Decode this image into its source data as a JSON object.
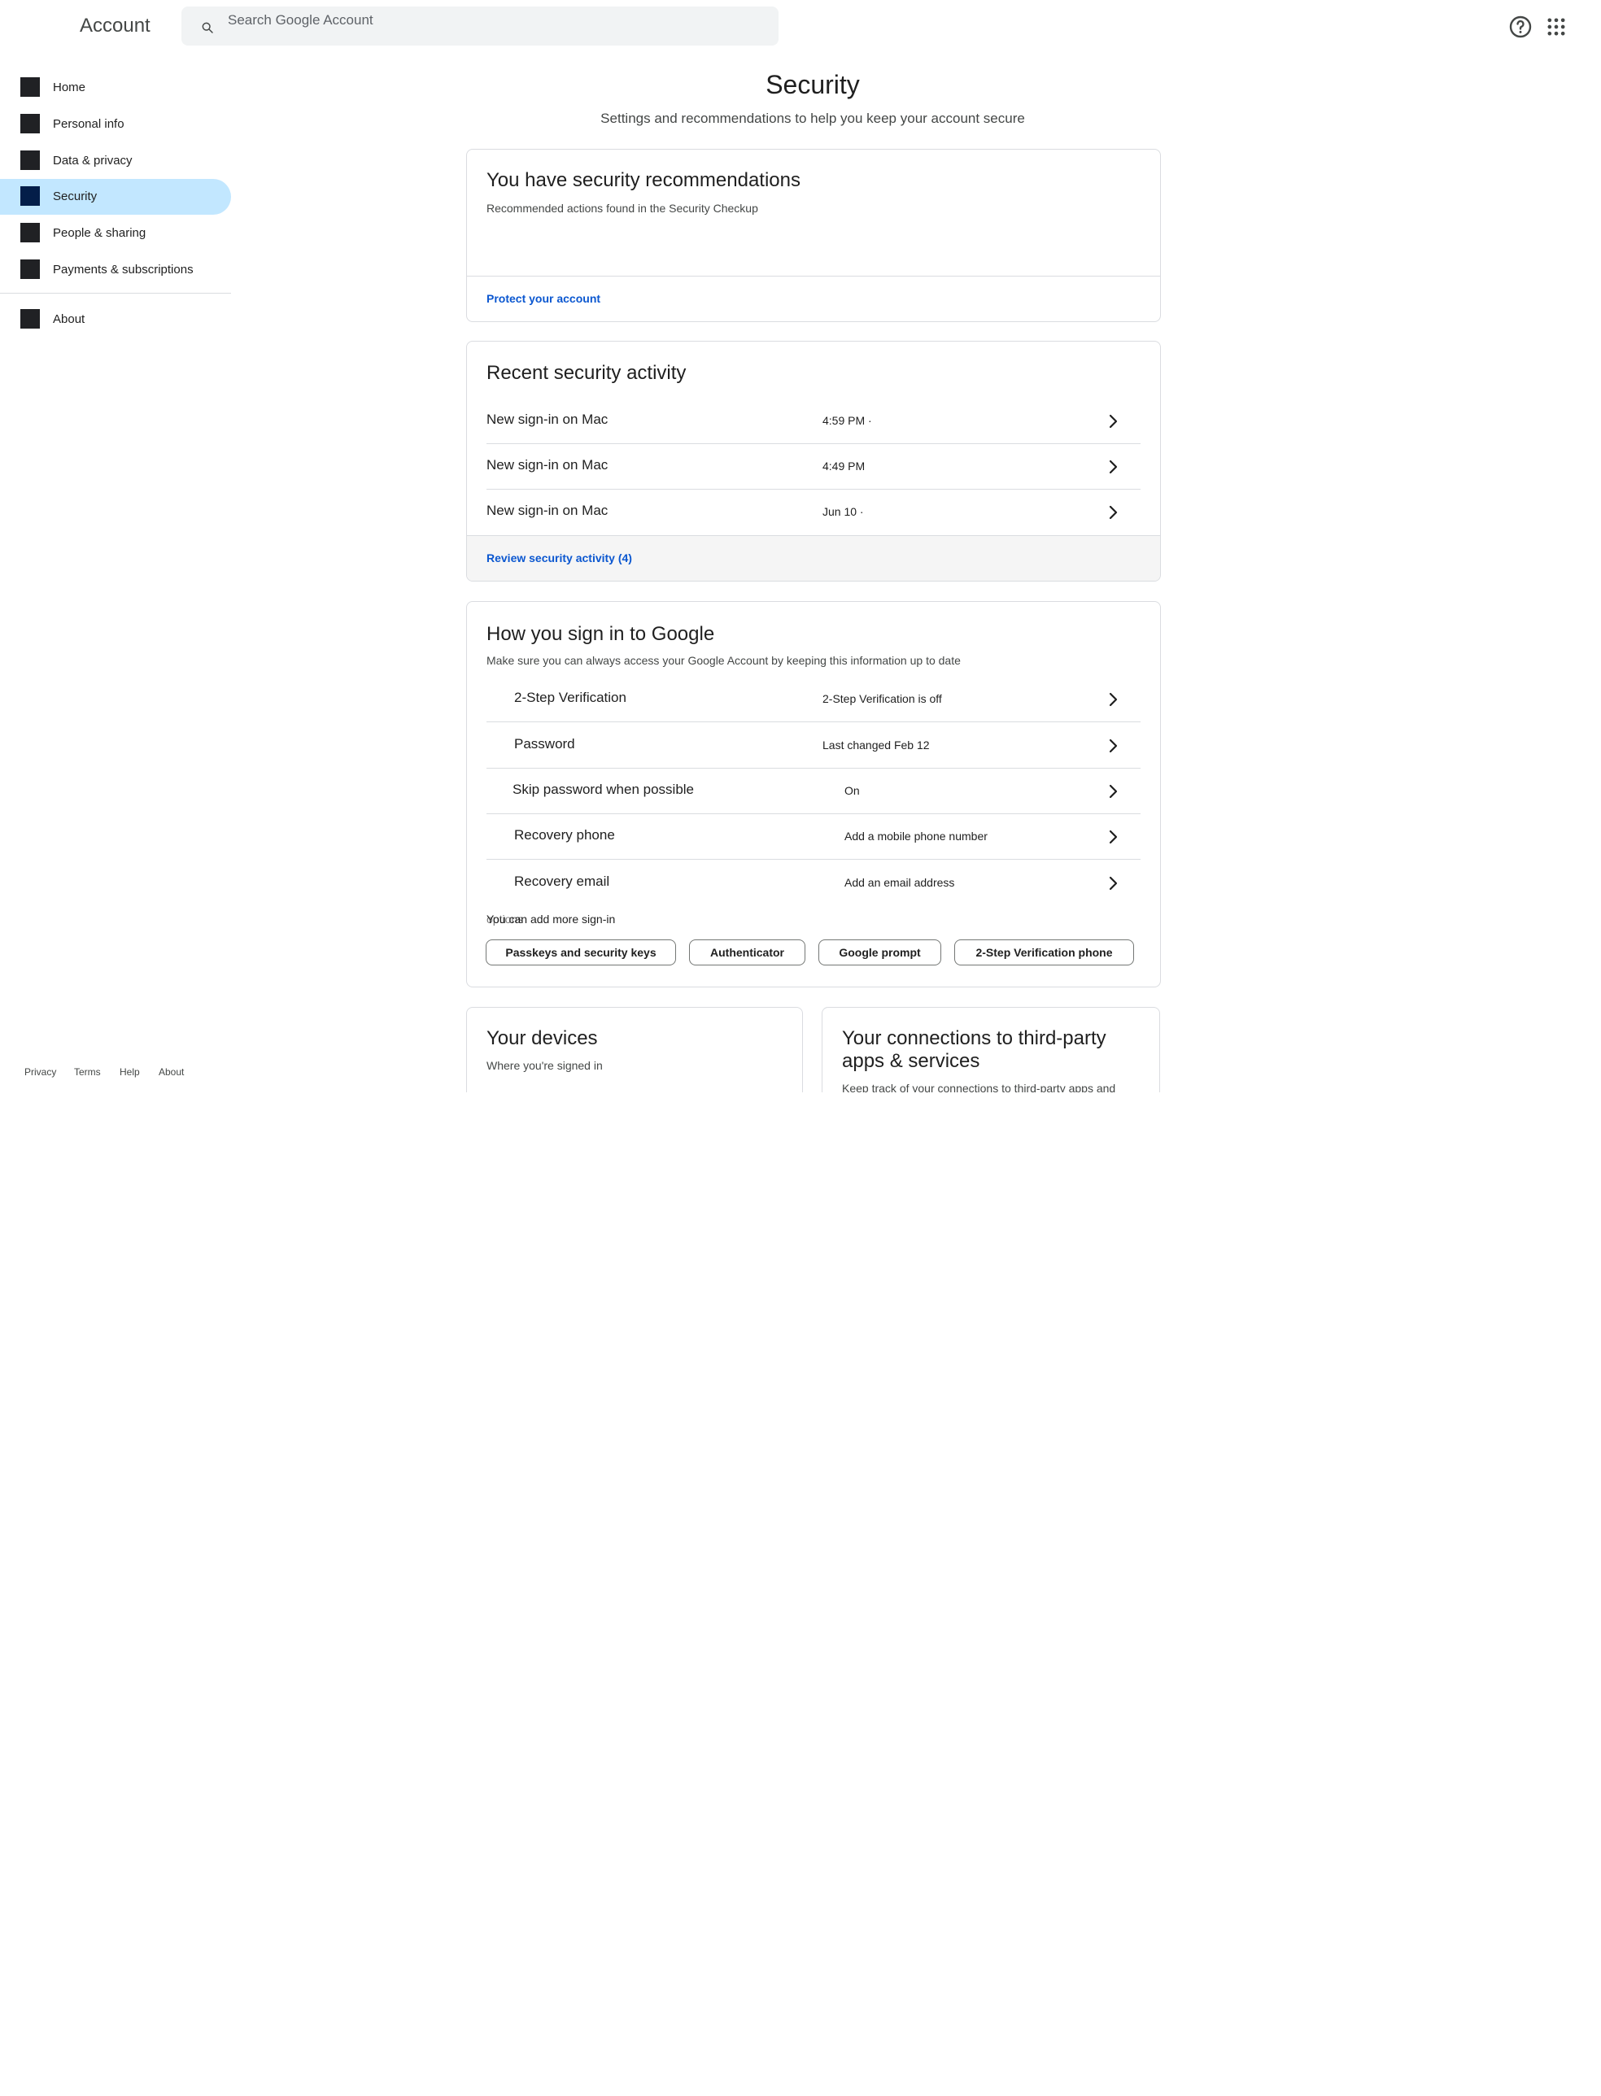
{
  "header": {
    "app_title": "Account",
    "search_placeholder": "Search Google Account"
  },
  "sidebar": {
    "items": [
      {
        "label": "Home",
        "icon": "home-icon"
      },
      {
        "label": "Personal info",
        "icon": "person-icon"
      },
      {
        "label": "Data & privacy",
        "icon": "privacy-icon"
      },
      {
        "label": "Security",
        "icon": "lock-icon",
        "active": true
      },
      {
        "label": "People & sharing",
        "icon": "people-icon"
      },
      {
        "label": "Payments & subscriptions",
        "icon": "payment-icon"
      },
      {
        "label": "About",
        "icon": "info-icon"
      }
    ],
    "footer": [
      "Privacy",
      "Terms",
      "Help",
      "About"
    ]
  },
  "page": {
    "title": "Security",
    "subtitle": "Settings and recommendations to help you keep your account secure"
  },
  "recommendations": {
    "title": "You have security recommendations",
    "description": "Recommended actions found in the Security Checkup",
    "link": "Protect your account"
  },
  "activity": {
    "title": "Recent security activity",
    "rows": [
      {
        "event": "New sign-in on Mac",
        "time": "4:59 PM ·"
      },
      {
        "event": "New sign-in on Mac",
        "time": "4:49 PM"
      },
      {
        "event": "New sign-in on Mac",
        "time": "Jun 10 ·"
      }
    ],
    "link": "Review security activity (4)"
  },
  "signin": {
    "title": "How you sign in to Google",
    "description": "Make sure you can always access your Google Account by keeping this information up to date",
    "rows": [
      {
        "label": "2-Step Verification",
        "value": "2-Step Verification is off"
      },
      {
        "label": "Password",
        "value": "Last changed Feb 12"
      },
      {
        "label": "Skip password when possible",
        "value": "On"
      },
      {
        "label": "Recovery phone",
        "value": "Add a mobile phone number"
      },
      {
        "label": "Recovery email",
        "value": "Add an email address"
      }
    ],
    "more_options_text": "You can add more sign-in",
    "more_options_overlap": "options",
    "chips": [
      "Passkeys and security keys",
      "Authenticator",
      "Google prompt",
      "2-Step Verification phone"
    ]
  },
  "devices": {
    "title": "Your devices",
    "description": "Where you're signed in"
  },
  "connections": {
    "title_line1": "Your connections to third-party",
    "title_line2": "apps & services",
    "description": "Keep track of your connections to third-party apps and"
  },
  "colors": {
    "active_nav_bg": "#c2e7ff",
    "link": "#0b57d0",
    "border": "#dadce0",
    "search_bg": "#f1f3f4"
  }
}
